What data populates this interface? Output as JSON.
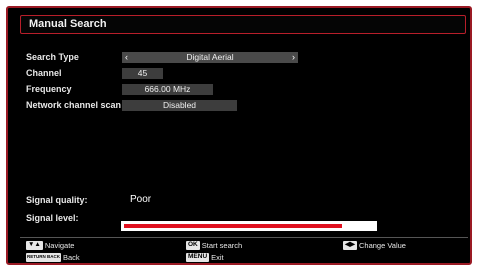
{
  "title": "Manual Search",
  "fields": {
    "search_type": {
      "label": "Search Type",
      "value": "Digital Aerial"
    },
    "channel": {
      "label": "Channel",
      "value": "45"
    },
    "frequency": {
      "label": "Frequency",
      "value": "666.00 MHz"
    },
    "network_scan": {
      "label": "Network channel scan",
      "value": "Disabled"
    }
  },
  "signal": {
    "quality_label": "Signal quality:",
    "quality_value": "Poor",
    "level_label": "Signal level:",
    "level_fraction": 0.87
  },
  "footer": {
    "navigate_label": "Navigate",
    "back_key": "RETURN BACK",
    "back_label": "Back",
    "ok_key": "OK",
    "start_label": "Start search",
    "menu_key": "MENU",
    "exit_label": "Exit",
    "change_label": "Change Value"
  },
  "colors": {
    "accent": "#b81e2a",
    "level_bar": "#e0101f",
    "background": "#000000"
  },
  "icons": [
    "up-down-arrows-icon",
    "left-right-arrows-icon",
    "left-arrow-icon",
    "right-arrow-icon"
  ]
}
